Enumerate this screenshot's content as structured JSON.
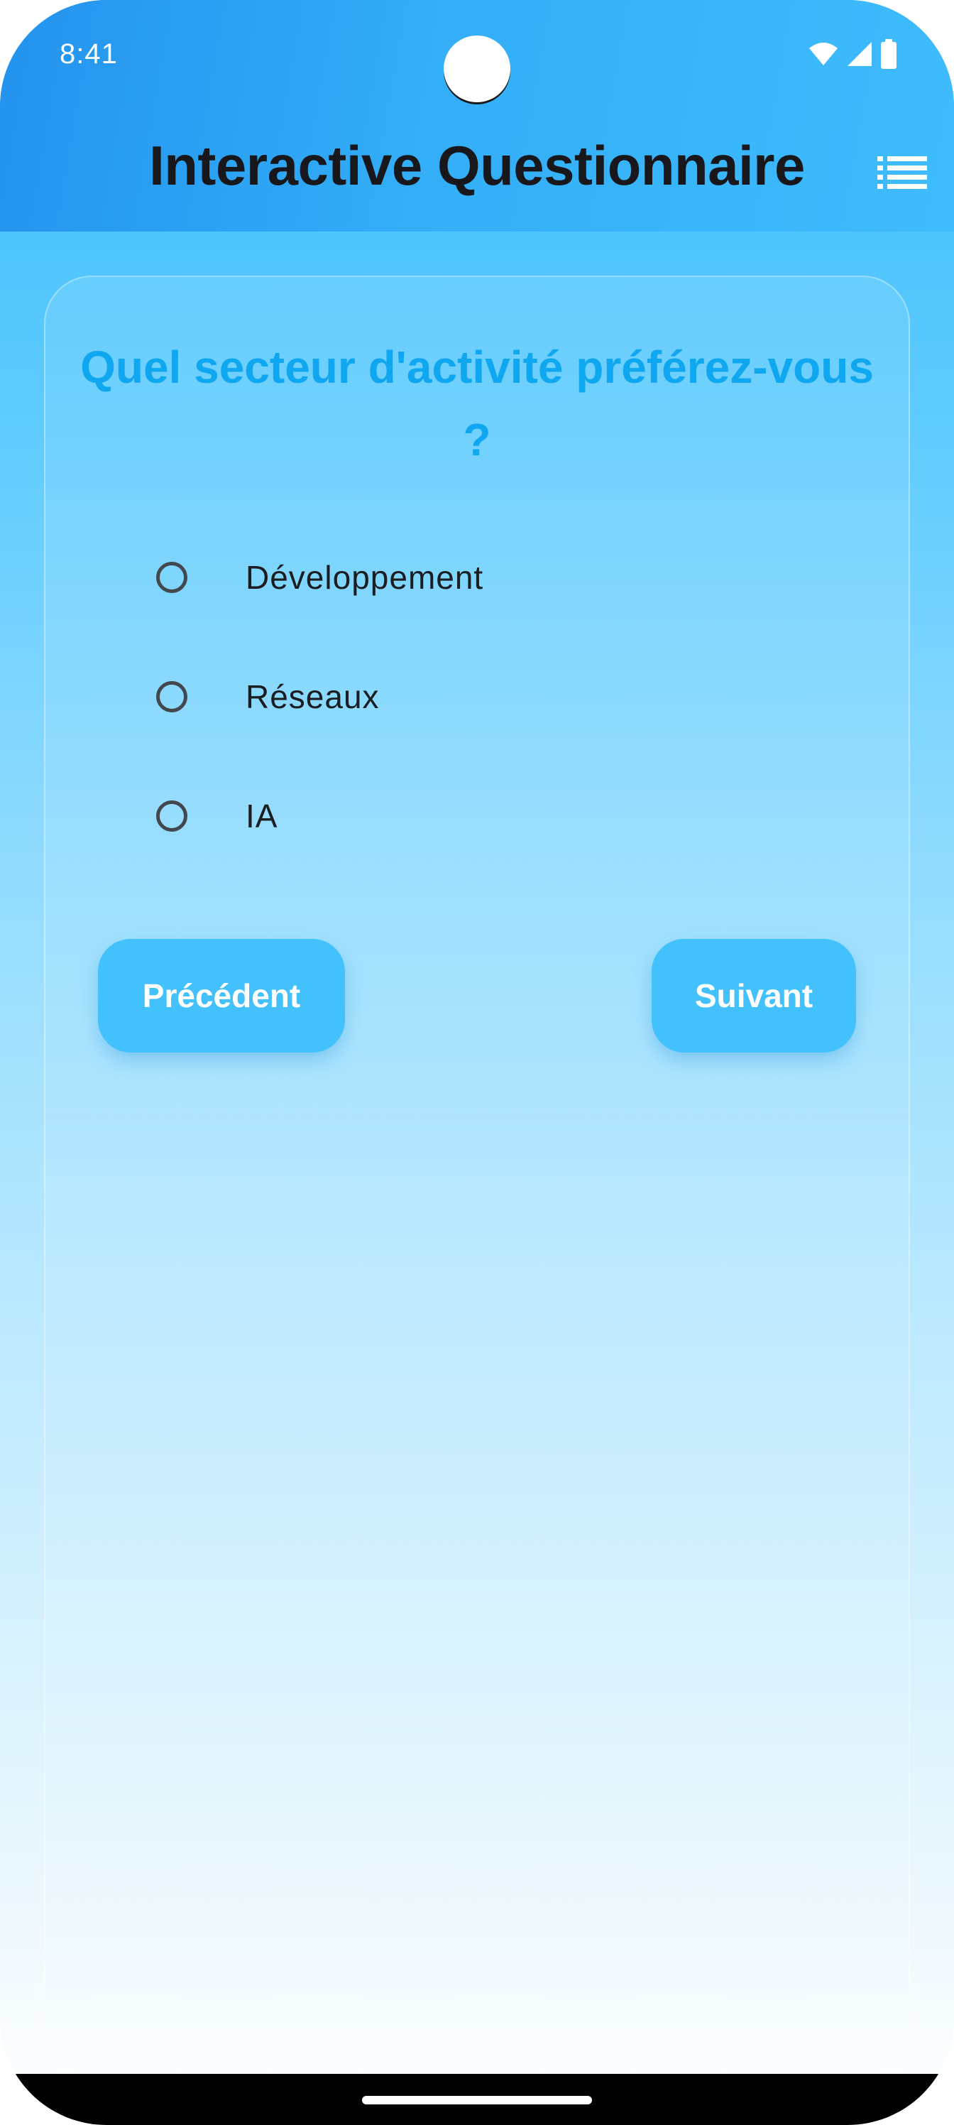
{
  "status_bar": {
    "time": "8:41",
    "icons": [
      "wifi-icon",
      "cell-signal-icon",
      "battery-icon"
    ]
  },
  "header": {
    "title": "Interactive Questionnaire",
    "menu_icon": "list-menu-icon"
  },
  "question": {
    "text": "Quel secteur d'activité préférez-vous ?",
    "options": [
      {
        "label": "Développement",
        "selected": false
      },
      {
        "label": "Réseaux",
        "selected": false
      },
      {
        "label": "IA",
        "selected": false
      }
    ]
  },
  "buttons": {
    "previous_label": "Précédent",
    "next_label": "Suivant"
  },
  "colors": {
    "header_start": "#2393ee",
    "header_end": "#3fbcfd",
    "question_text": "#0fa7ef",
    "button": "#42c1fc"
  }
}
